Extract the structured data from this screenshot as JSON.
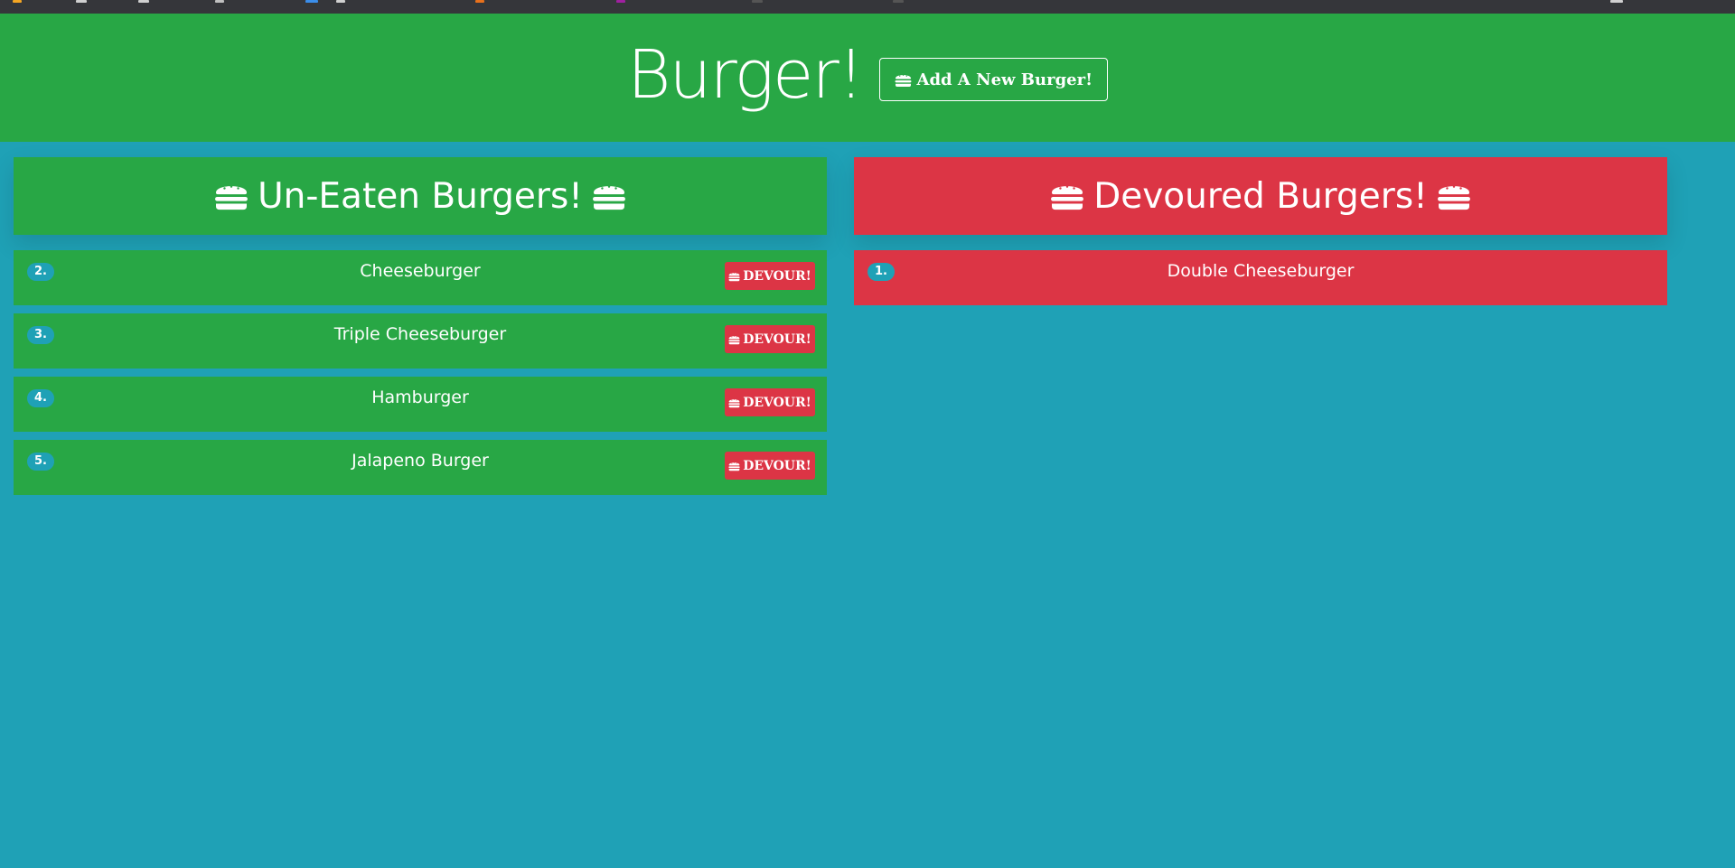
{
  "header": {
    "title": "Burger!",
    "add_button_label": "Add A New Burger!"
  },
  "uneaten": {
    "title": "Un-Eaten Burgers!",
    "items": [
      {
        "number": "2.",
        "name": "Cheeseburger",
        "button": "DEVOUR!"
      },
      {
        "number": "3.",
        "name": "Triple Cheeseburger",
        "button": "DEVOUR!"
      },
      {
        "number": "4.",
        "name": "Hamburger",
        "button": "DEVOUR!"
      },
      {
        "number": "5.",
        "name": "Jalapeno Burger",
        "button": "DEVOUR!"
      }
    ]
  },
  "devoured": {
    "title": "Devoured Burgers!",
    "items": [
      {
        "number": "1.",
        "name": "Double Cheeseburger"
      }
    ]
  },
  "colors": {
    "background": "#1fa1b6",
    "green": "#28a745",
    "red": "#dc3545",
    "text": "#ffffff"
  },
  "icons": {
    "burger": "hamburger-icon"
  }
}
